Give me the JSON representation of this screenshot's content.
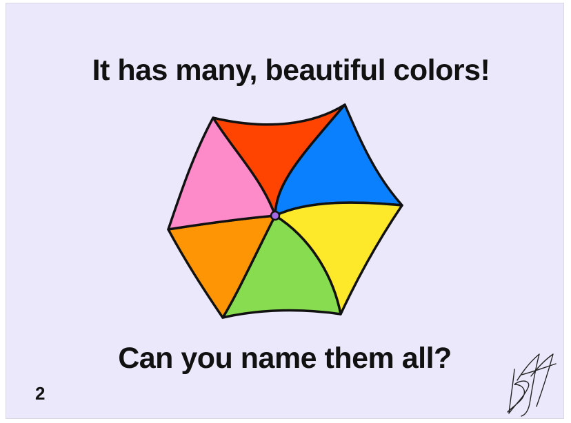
{
  "slide": {
    "headline": "It has many, beautiful colors!",
    "question": "Can you name them all?",
    "page_number": "2"
  },
  "pinwheel": {
    "segments": [
      {
        "name": "red",
        "color": "#fe4400"
      },
      {
        "name": "blue",
        "color": "#0a80ff"
      },
      {
        "name": "yellow",
        "color": "#fde82a"
      },
      {
        "name": "green",
        "color": "#88dc4f"
      },
      {
        "name": "orange",
        "color": "#fe9505"
      },
      {
        "name": "pink",
        "color": "#fd8ac9"
      }
    ],
    "center_color": "#a569e6",
    "outline_color": "#111111"
  },
  "signature": {
    "type": "handwritten-signature",
    "color": "#222222"
  }
}
